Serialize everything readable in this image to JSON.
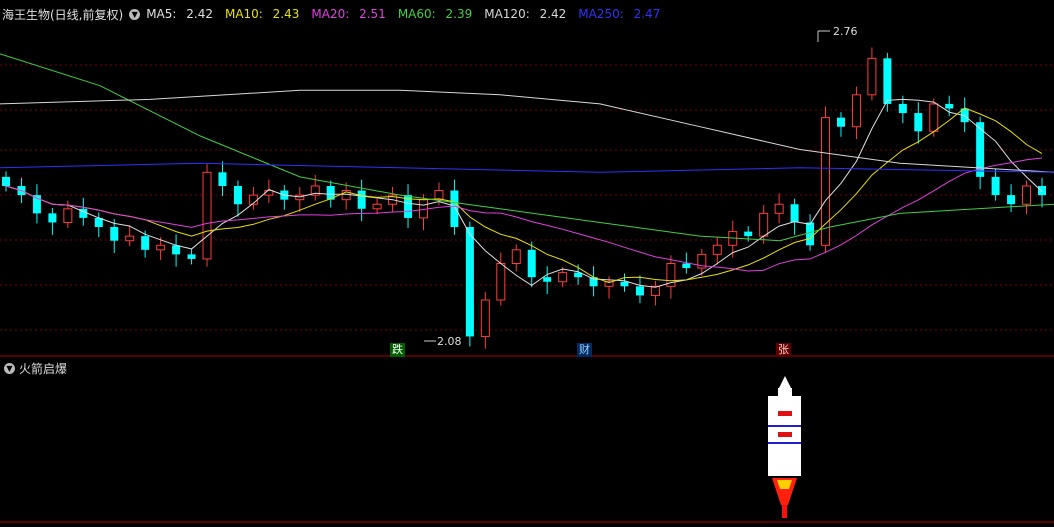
{
  "header": {
    "stock_name": "海王生物(日线,前复权)",
    "ma": [
      {
        "label": "MA5: ",
        "value": "2.42",
        "color": "#e0e0e0"
      },
      {
        "label": "MA10: ",
        "value": "2.43",
        "color": "#e8e000"
      },
      {
        "label": "MA20: ",
        "value": "2.51",
        "color": "#e040e0"
      },
      {
        "label": "MA60: ",
        "value": "2.39",
        "color": "#40d040"
      },
      {
        "label": "MA120: ",
        "value": "2.42",
        "color": "#d8d8d8"
      },
      {
        "label": "MA250: ",
        "value": "2.47",
        "color": "#3030ff"
      }
    ]
  },
  "annotations": {
    "high_label": "2.76",
    "low_label": "2.08",
    "marker_die": "跌",
    "marker_cai": "财",
    "marker_zhang": "张"
  },
  "sub_panel": {
    "title": "火箭启爆"
  },
  "colors": {
    "up": "#ff3c3c",
    "down": "#00ffff",
    "grid": "#7a0000"
  },
  "chart_data": {
    "type": "candlestick",
    "title": "海王生物(日线,前复权)",
    "high_marked": 2.76,
    "low_marked": 2.08,
    "ohlc_close_sequence": [
      2.42,
      2.4,
      2.36,
      2.34,
      2.37,
      2.35,
      2.33,
      2.3,
      2.31,
      2.28,
      2.29,
      2.27,
      2.26,
      2.45,
      2.42,
      2.38,
      2.4,
      2.41,
      2.39,
      2.4,
      2.42,
      2.39,
      2.41,
      2.37,
      2.38,
      2.4,
      2.35,
      2.39,
      2.41,
      2.33,
      2.09,
      2.17,
      2.25,
      2.28,
      2.22,
      2.21,
      2.23,
      2.22,
      2.2,
      2.21,
      2.2,
      2.18,
      2.2,
      2.25,
      2.24,
      2.27,
      2.29,
      2.32,
      2.31,
      2.36,
      2.38,
      2.34,
      2.29,
      2.57,
      2.55,
      2.62,
      2.7,
      2.6,
      2.58,
      2.54,
      2.6,
      2.59,
      2.56,
      2.44,
      2.4,
      2.38,
      2.42,
      2.4
    ]
  }
}
